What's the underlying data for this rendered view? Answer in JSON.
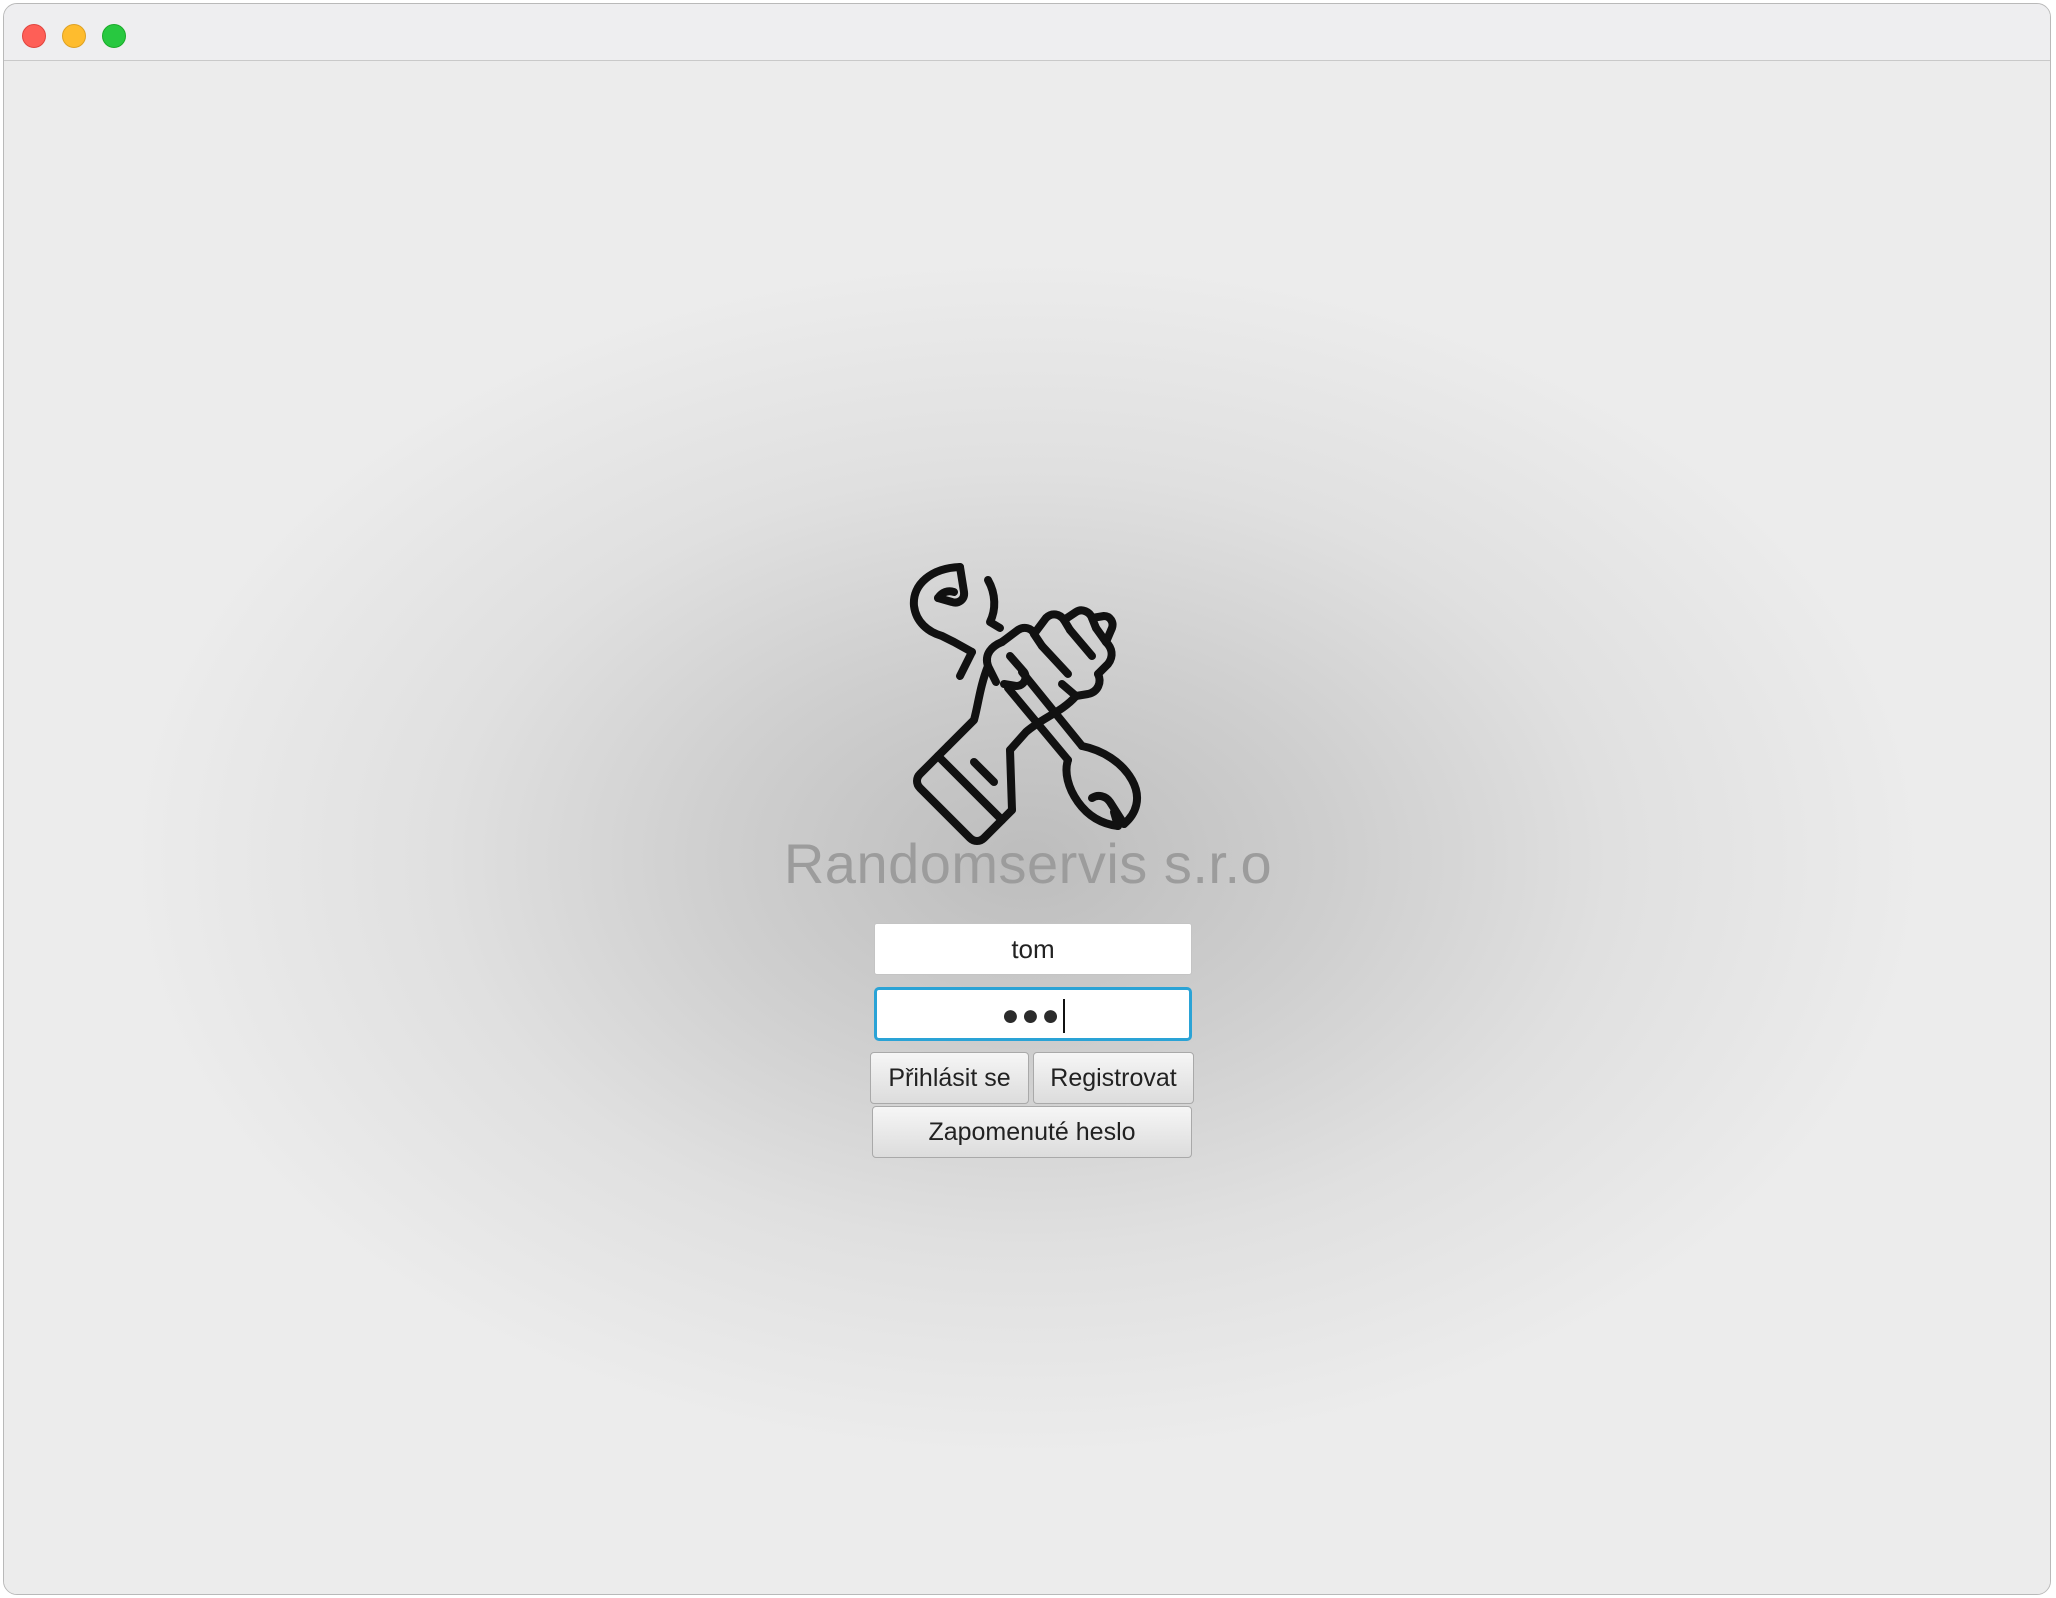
{
  "window": {
    "controls": {
      "close": "close-icon",
      "minimize": "minimize-icon",
      "maximize": "maximize-icon"
    }
  },
  "login": {
    "logo_icon": "hand-holding-wrench-icon",
    "company_name": "Randomservis s.r.o",
    "username_value": "tom",
    "password_masked": "●●●",
    "login_label": "Přihlásit se",
    "register_label": "Registrovat",
    "forgot_label": "Zapomenuté heslo"
  },
  "colors": {
    "focus_ring": "#2aa3d6",
    "company_text": "#9c9c9c"
  }
}
